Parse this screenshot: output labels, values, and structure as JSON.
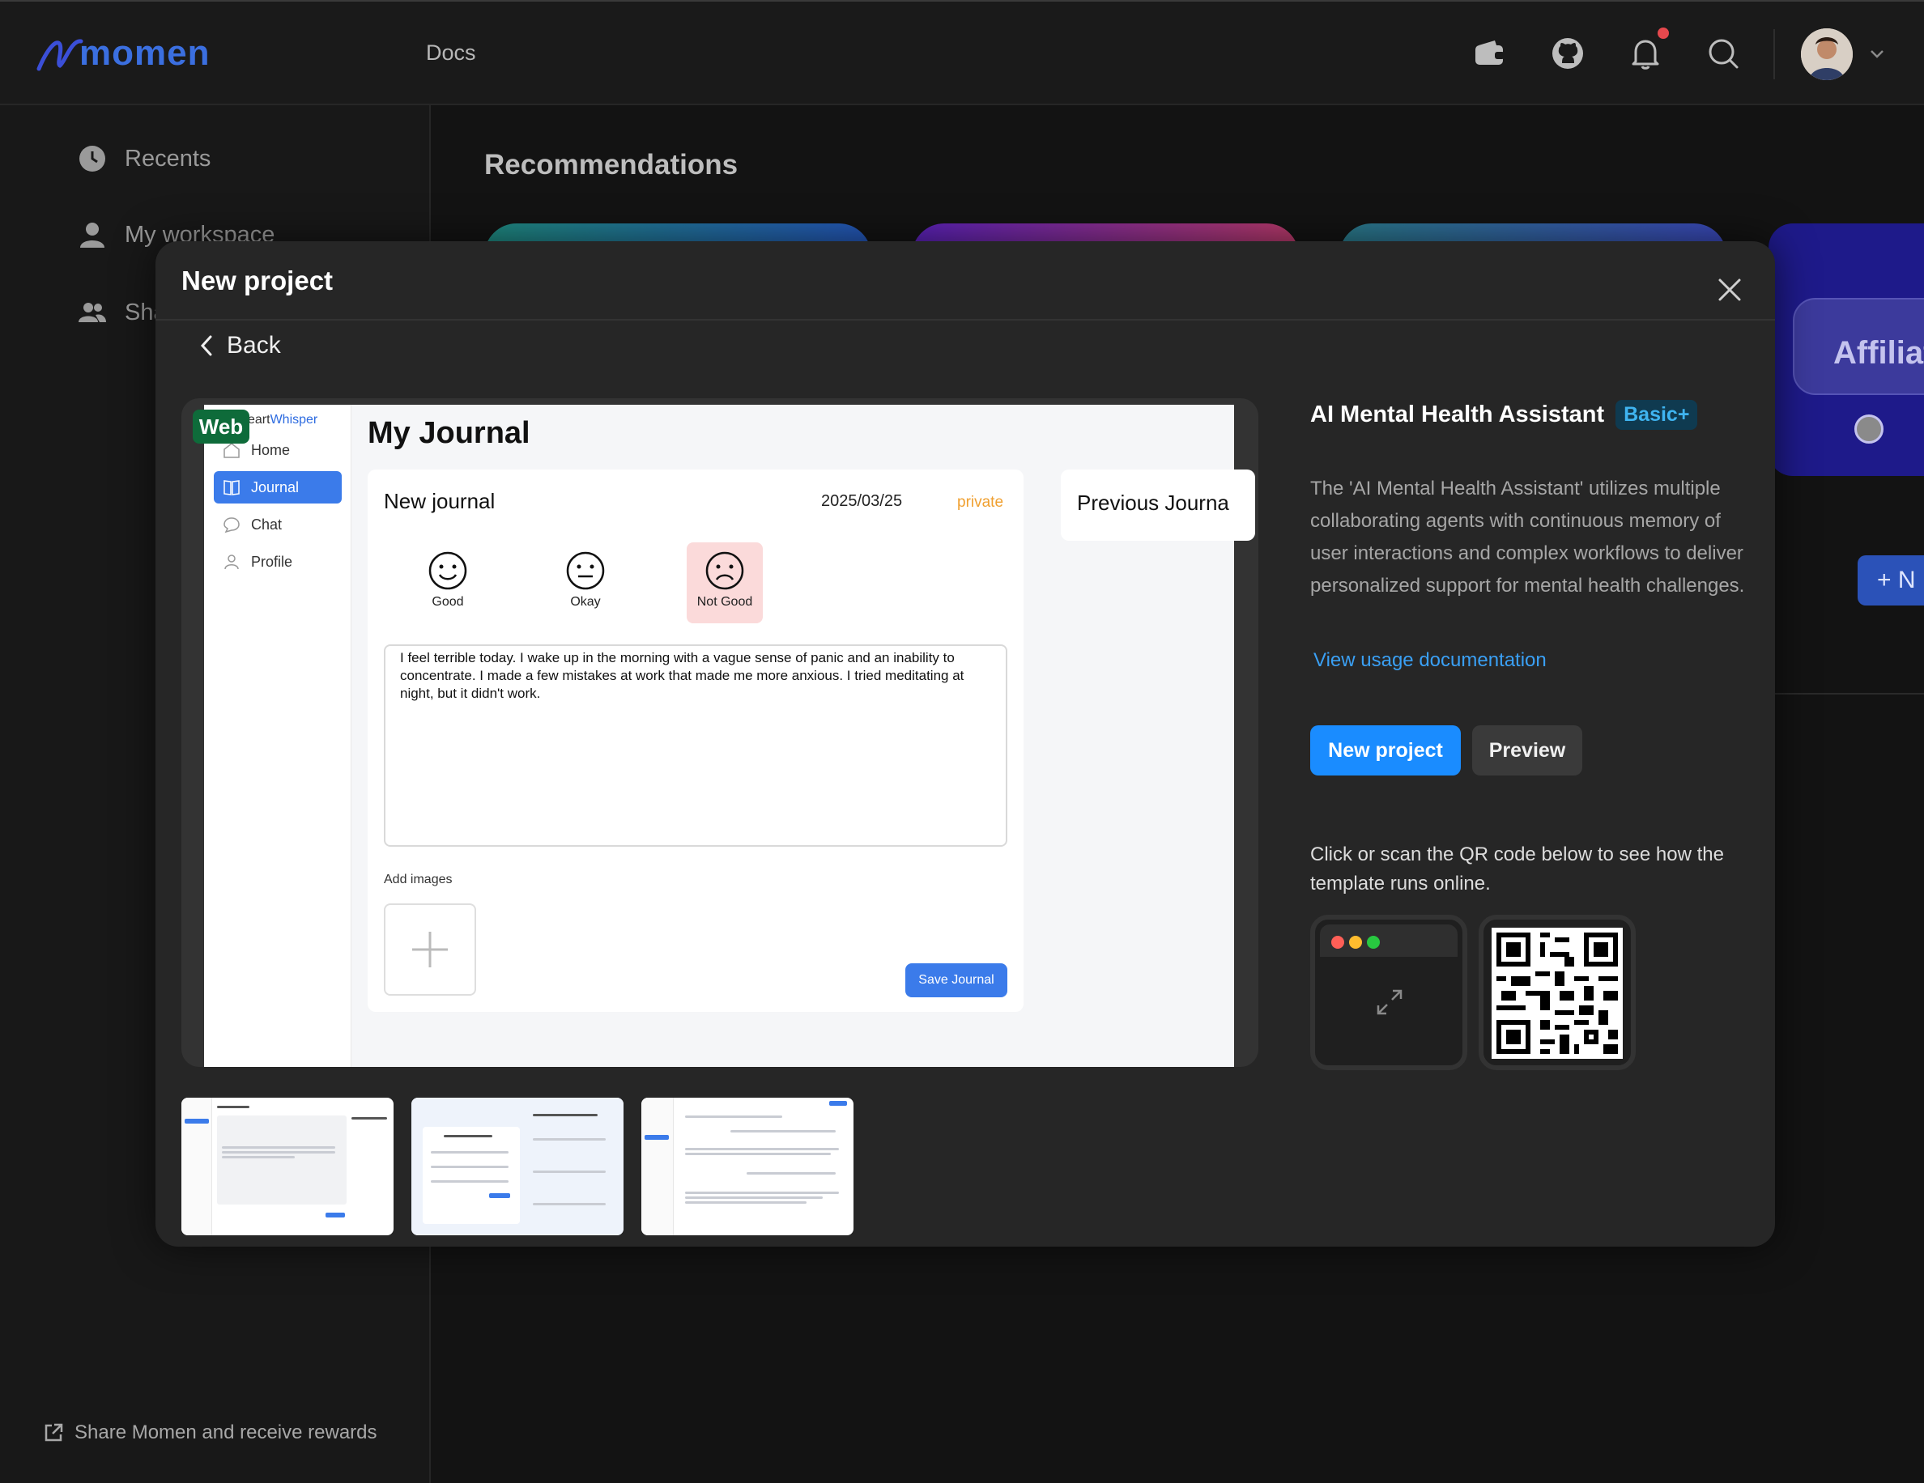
{
  "topbar": {
    "logo_text": "momen",
    "docs_label": "Docs",
    "icons": [
      "wallet-icon",
      "github-icon",
      "bell-icon",
      "search-icon"
    ],
    "accent_color": "#3b6fe0"
  },
  "sidebar": {
    "items": [
      {
        "label": "Recents",
        "icon": "clock-icon"
      },
      {
        "label": "My workspace",
        "icon": "user-icon"
      },
      {
        "label": "Sha",
        "icon": "users-icon"
      }
    ],
    "share_label": "Share Momen and receive rewards"
  },
  "main": {
    "recommendations_title": "Recommendations",
    "right_card_label": "Affiliat",
    "right_button_label": "N"
  },
  "modal": {
    "title": "New project",
    "back_label": "Back",
    "preview": {
      "platform_badge": "Web",
      "app": {
        "brand_prefix": "eart",
        "brand_suffix": "Whisper",
        "nav": [
          {
            "label": "Home",
            "active": false
          },
          {
            "label": "Journal",
            "active": true
          },
          {
            "label": "Chat",
            "active": false
          },
          {
            "label": "Profile",
            "active": false
          }
        ],
        "page_title": "My Journal",
        "card_title": "New journal",
        "date": "2025/03/25",
        "visibility": "private",
        "moods": [
          {
            "label": "Good",
            "selected": false
          },
          {
            "label": "Okay",
            "selected": false
          },
          {
            "label": "Not Good",
            "selected": true
          }
        ],
        "entry_text": "I feel terrible today. I wake up in the morning with a vague sense of panic and an inability to concentrate. I made a few mistakes at work that made me more anxious. I tried meditating at night, but it didn't work.",
        "add_images_label": "Add images",
        "save_label": "Save Journal",
        "previous_title": "Previous Journa"
      }
    },
    "thumbnails": [
      {
        "name": "thumbnail-journal",
        "selected": true
      },
      {
        "name": "thumbnail-signup",
        "selected": false
      },
      {
        "name": "thumbnail-chat",
        "selected": false
      }
    ],
    "info": {
      "title": "AI Mental Health Assistant",
      "tier": "Basic+",
      "description": "The 'AI Mental Health Assistant' utilizes multiple collaborating agents with continuous memory of user interactions and complex workflows to deliver personalized support for mental health challenges.",
      "usage_link": "View usage documentation",
      "new_project_label": "New project",
      "preview_label": "Preview",
      "qr_note": "Click or scan the QR code below to see how the template runs online."
    }
  }
}
